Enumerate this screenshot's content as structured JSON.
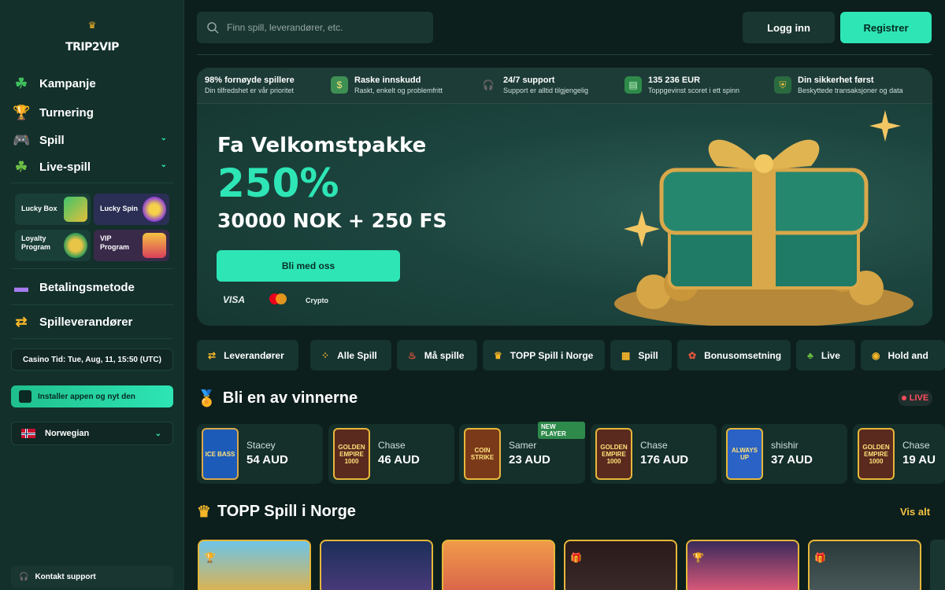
{
  "brand": {
    "logo_text": "TRIP2VIP"
  },
  "sidebar": {
    "nav": [
      {
        "label": "Kampanje",
        "icon": "clover-icon"
      },
      {
        "label": "Turnering",
        "icon": "trophy-icon"
      },
      {
        "label": "Spill",
        "icon": "gamepad-icon"
      },
      {
        "label": "Live-spill",
        "icon": "clover-icon"
      }
    ],
    "tiles": [
      {
        "label": "Lucky Box"
      },
      {
        "label": "Lucky Spin"
      },
      {
        "label": "Loyalty Program"
      },
      {
        "label": "VIP Program"
      }
    ],
    "payment_label": "Betalingsmetode",
    "providers_label": "Spilleverandører",
    "casino_time": "Casino Tid: Tue, Aug, 11, 15:50 (UTC)",
    "install_app": "Installer appen og nyt den",
    "language": "Norwegian",
    "support": "Kontakt support"
  },
  "header": {
    "search_placeholder": "Finn spill, leverandører, etc.",
    "login": "Logg inn",
    "register": "Registrer"
  },
  "banner": {
    "features": [
      {
        "title": "98% fornøyde spillere",
        "sub": "Din tilfredshet er vår prioritet"
      },
      {
        "title": "Raske innskudd",
        "sub": "Raskt, enkelt og problemfritt"
      },
      {
        "title": "24/7 support",
        "sub": "Support er alltid tilgjengelig"
      },
      {
        "title": "135 236 EUR",
        "sub": "Toppgevinst scoret i ett spinn"
      },
      {
        "title": "Din sikkerhet først",
        "sub": "Beskyttede transaksjoner og data"
      }
    ],
    "title": "Fa Velkomstpakke",
    "percent": "250%",
    "amount": "30000 NOK + 250 FS",
    "cta": "Bli med oss",
    "payments": [
      "VISA",
      "Crypto"
    ]
  },
  "categories": [
    "Leverandører",
    "Alle Spill",
    "Må spille",
    "TOPP Spill i Norge",
    "Spill",
    "Bonusomsetning",
    "Live",
    "Hold and"
  ],
  "winners": {
    "title": "Bli en av vinnerne",
    "live": "LIVE",
    "new_player_badge": "NEW PLAYER",
    "items": [
      {
        "name": "Stacey",
        "amount": "54 AUD",
        "game": "ICE BASS"
      },
      {
        "name": "Chase",
        "amount": "46 AUD",
        "game": "GOLDEN EMPIRE 1000"
      },
      {
        "name": "Samer",
        "amount": "23 AUD",
        "game": "COIN STRIKE"
      },
      {
        "name": "Chase",
        "amount": "176 AUD",
        "game": "GOLDEN EMPIRE 1000"
      },
      {
        "name": "shishir",
        "amount": "37 AUD",
        "game": "ALWAYS UP"
      },
      {
        "name": "Chase",
        "amount": "19 AU",
        "game": "GOLDEN EMPIRE 1000"
      }
    ]
  },
  "top_games": {
    "title": "TOPP Spill i Norge",
    "see_all": "Vis alt"
  },
  "colors": {
    "accent": "#2ee5b5",
    "gold": "#e6b73a",
    "live": "#ff4d5c"
  }
}
